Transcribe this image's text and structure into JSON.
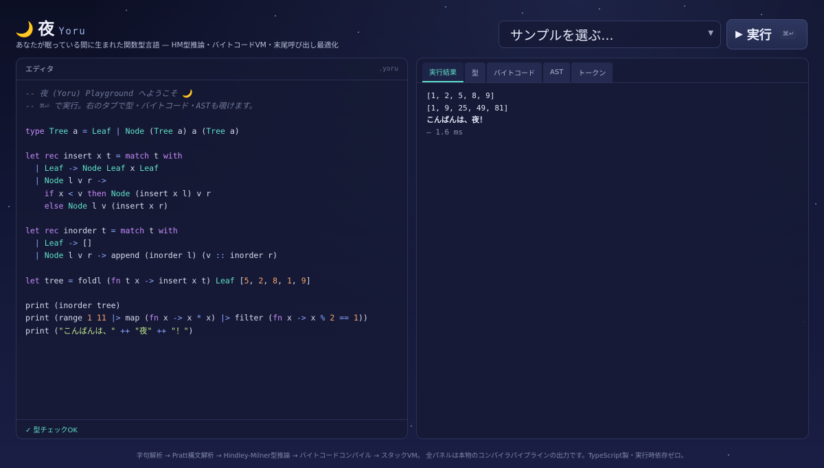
{
  "header": {
    "moon_icon": "🌙",
    "title_kanji": "夜",
    "title_latin": "Yoru",
    "subtitle": "あなたが眠っている間に生まれた関数型言語 — HM型推論・バイトコードVM・末尾呼び出し最適化"
  },
  "sample_select": {
    "selected": "サンプルを選ぶ...",
    "icon": "chevron-down-icon"
  },
  "run_button": {
    "label": "実行",
    "icon": "play-icon",
    "shortcut": "⌘↵"
  },
  "editor": {
    "label": "エディタ",
    "extension": ".yoru",
    "status": "✓ 型チェックOK",
    "code_lines": [
      "-- 夜 (Yoru) Playground へようこそ 🌙",
      "-- ⌘⏎ で実行。右のタブで型・バイトコード・ASTも覗けます。",
      "",
      "type Tree a = Leaf | Node (Tree a) a (Tree a)",
      "",
      "let rec insert x t = match t with",
      "  | Leaf -> Node Leaf x Leaf",
      "  | Node l v r ->",
      "    if x < v then Node (insert x l) v r",
      "    else Node l v (insert x r)",
      "",
      "let rec inorder t = match t with",
      "  | Leaf -> []",
      "  | Node l v r -> append (inorder l) (v :: inorder r)",
      "",
      "let tree = foldl (fn t x -> insert x t) Leaf [5, 2, 8, 1, 9]",
      "",
      "print (inorder tree)",
      "print (range 1 11 |> map (fn x -> x * x) |> filter (fn x -> x % 2 == 1))",
      "print (\"こんばんは、\" ++ \"夜\" ++ \"！\")"
    ]
  },
  "output": {
    "tabs": [
      "実行結果",
      "型",
      "バイトコード",
      "AST",
      "トークン"
    ],
    "active_tab": 0,
    "lines": [
      "[1, 2, 5, 8, 9]",
      "[1, 9, 25, 49, 81]",
      "こんばんは、夜！"
    ],
    "timing": "— 1.6 ms"
  },
  "footer": "字句解析 → Pratt構文解析 → Hindley-Milner型推論 → バイトコードコンパイル → スタックVM。 全パネルは本物のコンパイラパイプラインの出力です。TypeScript製・実行時依存ゼロ。",
  "colors": {
    "accent": "#5fe0c8",
    "keyword": "#c58af9",
    "type": "#5fe0c8",
    "number": "#f7a46a",
    "string": "#c3e88d",
    "comment": "#6f7898"
  }
}
